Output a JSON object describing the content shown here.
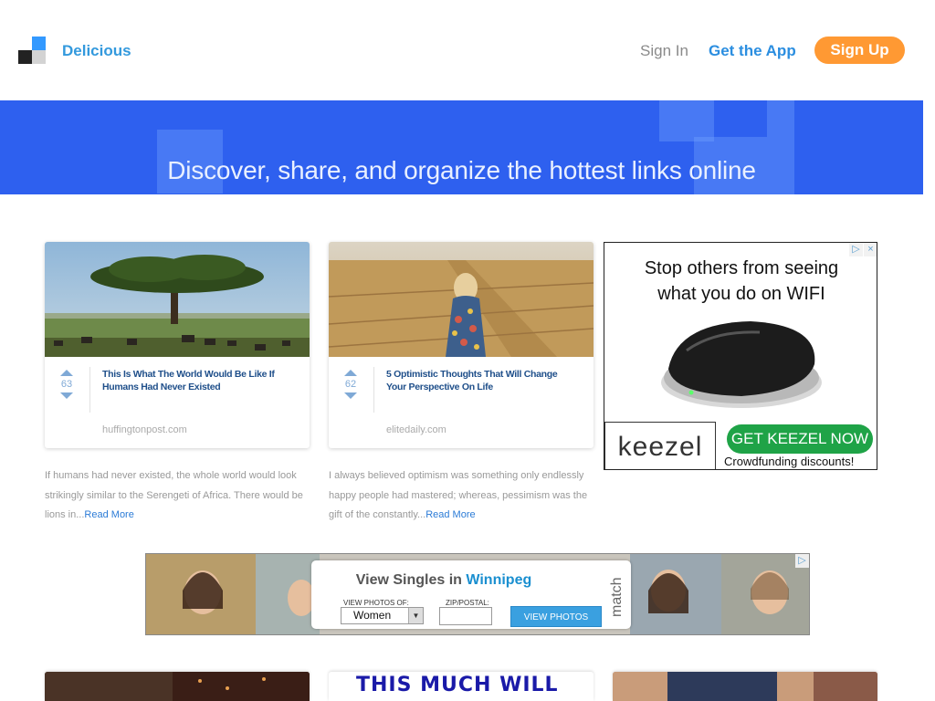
{
  "header": {
    "brand": "Delicious",
    "nav": {
      "sign_in": "Sign In",
      "get_app": "Get the App",
      "sign_up": "Sign Up"
    }
  },
  "hero": {
    "tagline": "Discover, share, and organize the hottest links online"
  },
  "cards": [
    {
      "votes": "63",
      "title": "This Is What The World Would Be Like If Humans Had Never Existed",
      "domain": "huffingtonpost.com",
      "description": "If humans had never existed, the whole world would look strikingly similar to the Serengeti of Africa. There would be lions in...",
      "read_more": "Read More"
    },
    {
      "votes": "62",
      "title": "5 Optimistic Thoughts That Will Change Your Perspective On Life",
      "domain": "elitedaily.com",
      "description": "I always believed optimism was something only endlessly happy people had mastered; whereas, pessimism was the gift of the constantly...",
      "read_more": "Read More"
    }
  ],
  "ad_keezel": {
    "headline_1": "Stop others from seeing",
    "headline_2": "what you do on WIFI",
    "logo": "keezel",
    "cta": "GET KEEZEL NOW",
    "sub": "Crowdfunding discounts!",
    "close": "×",
    "adchoices": "▷"
  },
  "ad_match": {
    "title_prefix": "View Singles in ",
    "city": "Winnipeg",
    "photos_of_label": "VIEW PHOTOS OF:",
    "photos_of_value": "Women",
    "zip_label": "ZIP/POSTAL:",
    "zip_value": "",
    "button": "VIEW PHOTOS",
    "brand": "match",
    "adchoices": "▷"
  },
  "teasers": [
    {
      "text": ""
    },
    {
      "text": "THIS MUCH WILL"
    },
    {
      "text": ""
    }
  ],
  "colors": {
    "brand_blue": "#3399dd",
    "hero_blue": "#2e60ef",
    "signup_orange": "#ff9933",
    "ad_green": "#1fa347"
  }
}
